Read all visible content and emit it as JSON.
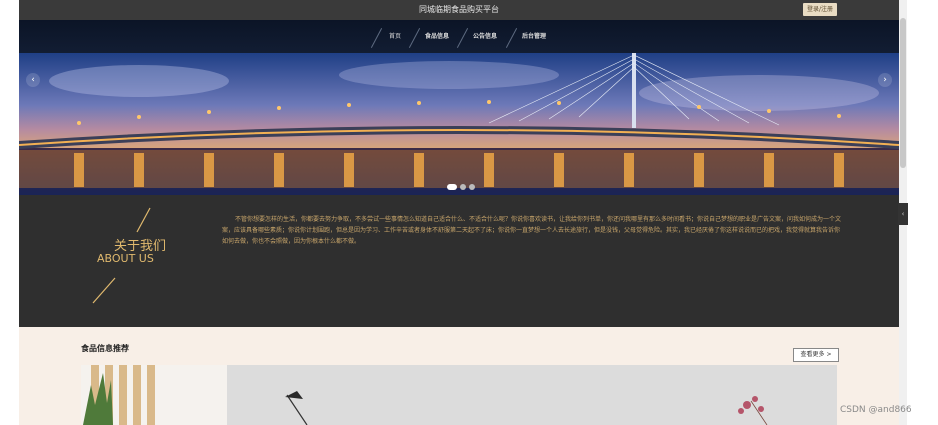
{
  "header": {
    "site_title": "同城临期食品购买平台",
    "login_label": "登录/注册"
  },
  "nav": {
    "items": [
      {
        "label": "首页"
      },
      {
        "label": "食品信息"
      },
      {
        "label": "公告信息"
      },
      {
        "label": "后台管理"
      }
    ]
  },
  "banner": {
    "prev_icon": "‹",
    "next_icon": "›",
    "active_slide": 1,
    "slide_count": 3
  },
  "about": {
    "title_cn": "关于我们",
    "title_en": "ABOUT US",
    "text": "不管你想要怎样的生活，你都要去努力争取，不多尝试一些事情怎么知道自己适合什么、不适合什么呢？你说你喜欢读书，让我给你列书单，你还问我哪里有那么多时间看书；你说自己梦想的职业是广告文案，问我如何成为一个文案，应该具备哪些素质；你说你计划围跑，但总是因为学习、工作辛苦或者身体不舒服第二天起不了床；你说你一直梦想一个人去长途旅行，但是没钱，父母觉得危险。其实，我已经厌倦了你这样说说而已的把戏，我觉得就算我告诉你如何去做，你也不会照做，因为你根本什么都不做。"
  },
  "recommend": {
    "title": "食品信息推荐",
    "more_label": "查看更多 >"
  },
  "watermark": "CSDN @and866",
  "side_tab_icon": "‹"
}
